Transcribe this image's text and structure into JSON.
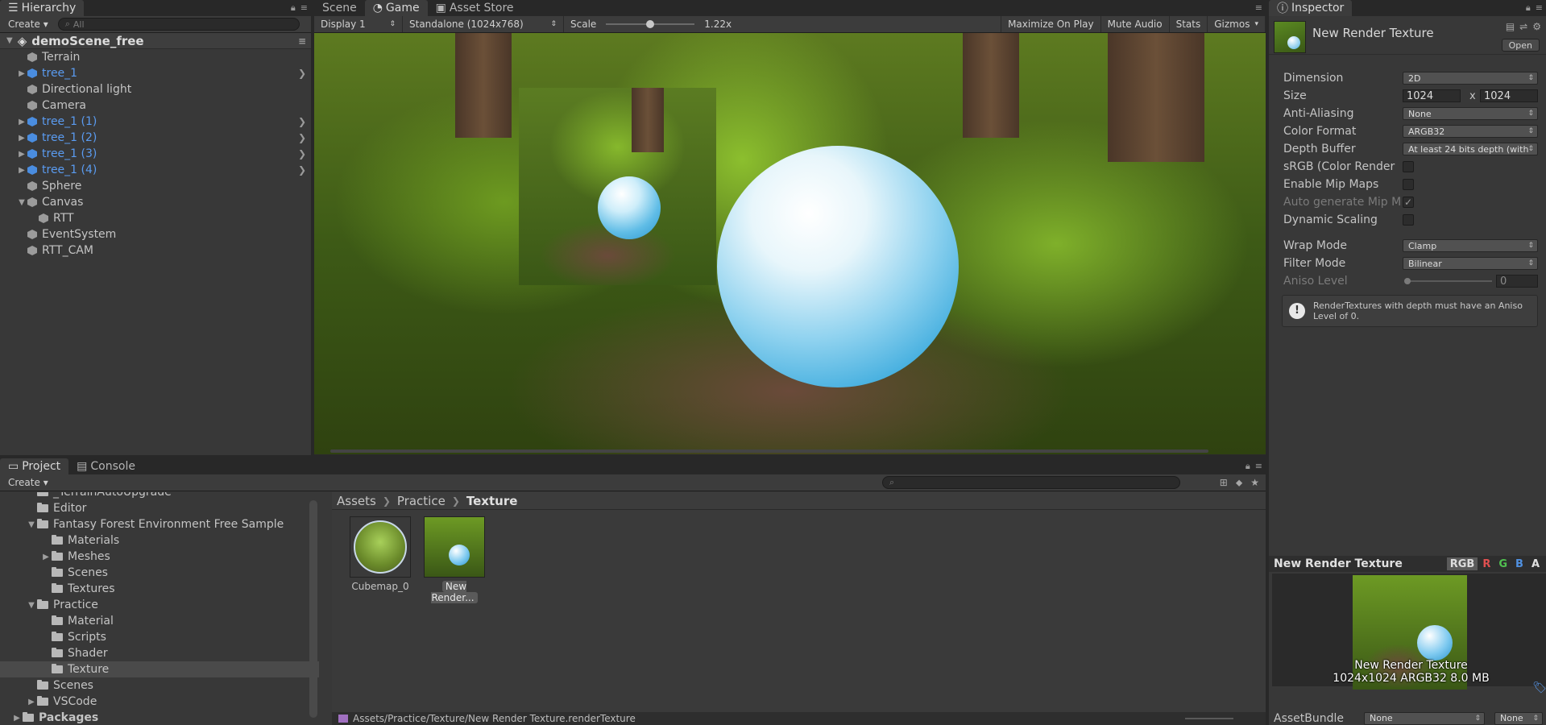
{
  "hierarchy": {
    "tab": "Hierarchy",
    "create": "Create",
    "search_placeholder": "All",
    "scene": "demoScene_free",
    "items": [
      {
        "label": "Terrain",
        "indent": 0,
        "arrow": false,
        "prefab": false
      },
      {
        "label": "tree_1",
        "indent": 0,
        "arrow": true,
        "prefab": true
      },
      {
        "label": "Directional light",
        "indent": 0,
        "arrow": false,
        "prefab": false
      },
      {
        "label": "Camera",
        "indent": 0,
        "arrow": false,
        "prefab": false
      },
      {
        "label": "tree_1 (1)",
        "indent": 0,
        "arrow": true,
        "prefab": true
      },
      {
        "label": "tree_1 (2)",
        "indent": 0,
        "arrow": true,
        "prefab": true
      },
      {
        "label": "tree_1 (3)",
        "indent": 0,
        "arrow": true,
        "prefab": true
      },
      {
        "label": "tree_1 (4)",
        "indent": 0,
        "arrow": true,
        "prefab": true
      },
      {
        "label": "Sphere",
        "indent": 0,
        "arrow": false,
        "prefab": false
      },
      {
        "label": "Canvas",
        "indent": 0,
        "arrow": "open",
        "prefab": false
      },
      {
        "label": "RTT",
        "indent": 1,
        "arrow": false,
        "prefab": false
      },
      {
        "label": "EventSystem",
        "indent": 0,
        "arrow": false,
        "prefab": false
      },
      {
        "label": "RTT_CAM",
        "indent": 0,
        "arrow": false,
        "prefab": false
      }
    ]
  },
  "game": {
    "tabs": [
      "Scene",
      "Game",
      "Asset Store"
    ],
    "display": "Display 1",
    "resolution": "Standalone (1024x768)",
    "scale_label": "Scale",
    "scale_value": "1.22x",
    "maximize": "Maximize On Play",
    "mute": "Mute Audio",
    "stats": "Stats",
    "gizmos": "Gizmos"
  },
  "inspector": {
    "tab": "Inspector",
    "title": "New Render Texture",
    "open": "Open",
    "dimension": {
      "label": "Dimension",
      "value": "2D"
    },
    "size": {
      "label": "Size",
      "w": "1024",
      "x": "x",
      "h": "1024"
    },
    "anti_aliasing": {
      "label": "Anti-Aliasing",
      "value": "None"
    },
    "color_format": {
      "label": "Color Format",
      "value": "ARGB32"
    },
    "depth_buffer": {
      "label": "Depth Buffer",
      "value": "At least 24 bits depth (with"
    },
    "srgb": {
      "label": "sRGB (Color Render"
    },
    "mipmaps": {
      "label": "Enable Mip Maps"
    },
    "auto_mip": {
      "label": "Auto generate Mip M"
    },
    "dynamic_scaling": {
      "label": "Dynamic Scaling"
    },
    "wrap_mode": {
      "label": "Wrap Mode",
      "value": "Clamp"
    },
    "filter_mode": {
      "label": "Filter Mode",
      "value": "Bilinear"
    },
    "aniso": {
      "label": "Aniso Level",
      "value": "0"
    },
    "warning": "RenderTextures with depth must have an Aniso Level of 0.",
    "preview_title": "New Render Texture",
    "channels": [
      "RGB",
      "R",
      "G",
      "B",
      "A"
    ],
    "preview_name": "New Render Texture",
    "preview_info": "1024x1024  ARGB32  8.0 MB",
    "assetbundle_label": "AssetBundle",
    "assetbundle_value": "None",
    "assetbundle_variant": "None"
  },
  "project": {
    "tabs": [
      "Project",
      "Console"
    ],
    "create": "Create",
    "tree": [
      {
        "label": "_TerrainAutoUpgrade",
        "depth": 1,
        "arrow": ""
      },
      {
        "label": "Editor",
        "depth": 1,
        "arrow": ""
      },
      {
        "label": "Fantasy Forest Environment Free Sample",
        "depth": 1,
        "arrow": "▼"
      },
      {
        "label": "Materials",
        "depth": 2,
        "arrow": ""
      },
      {
        "label": "Meshes",
        "depth": 2,
        "arrow": "▶"
      },
      {
        "label": "Scenes",
        "depth": 2,
        "arrow": ""
      },
      {
        "label": "Textures",
        "depth": 2,
        "arrow": ""
      },
      {
        "label": "Practice",
        "depth": 1,
        "arrow": "▼"
      },
      {
        "label": "Material",
        "depth": 2,
        "arrow": ""
      },
      {
        "label": "Scripts",
        "depth": 2,
        "arrow": ""
      },
      {
        "label": "Shader",
        "depth": 2,
        "arrow": ""
      },
      {
        "label": "Texture",
        "depth": 2,
        "arrow": "",
        "selected": true
      },
      {
        "label": "Scenes",
        "depth": 1,
        "arrow": ""
      },
      {
        "label": "VSCode",
        "depth": 1,
        "arrow": "▶"
      },
      {
        "label": "Packages",
        "depth": 0,
        "arrow": "▶",
        "bold": true
      }
    ],
    "breadcrumb": [
      "Assets",
      "Practice",
      "Texture"
    ],
    "assets": [
      "Cubemap_0",
      "New Render..."
    ],
    "status_path": "Assets/Practice/Texture/New Render Texture.renderTexture"
  }
}
